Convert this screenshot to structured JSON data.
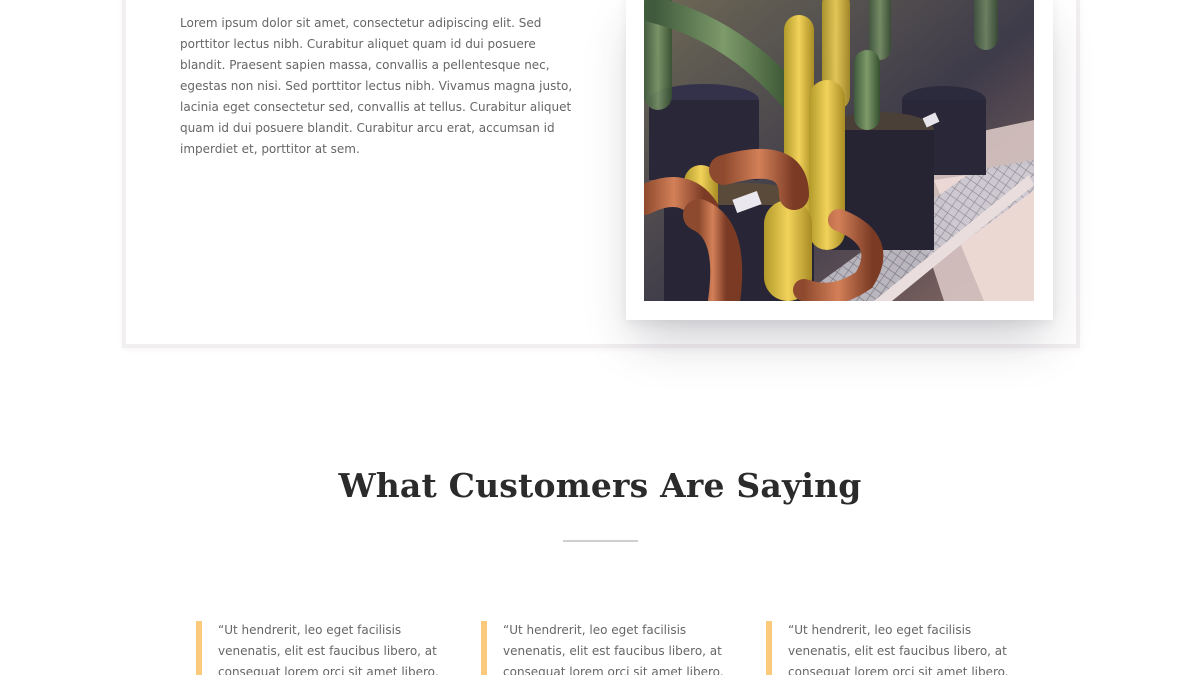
{
  "feature": {
    "body": "Lorem ipsum dolor sit amet, consectetur adipiscing elit. Sed porttitor lectus nibh. Curabitur aliquet quam id dui posuere blandit. Praesent sapien massa, convallis a pellentesque nec, egestas non nisi. Sed porttitor lectus nibh. Vivamus magna justo, lacinia eget consectetur sed, convallis at tellus. Curabitur aliquet quam id dui posuere blandit. Curabitur arcu erat, accumsan id imperdiet et, porttitor at sem.",
    "image_subject": "potted cacti photo"
  },
  "testimonials": {
    "title": "What Customers Are Saying",
    "accent_color": "#fcca7d",
    "items": [
      {
        "quote": "“Ut hendrerit, leo eget facilisis venenatis, elit est faucibus libero, at consequat lorem orci sit amet libero."
      },
      {
        "quote": "“Ut hendrerit, leo eget facilisis venenatis, elit est faucibus libero, at consequat lorem orci sit amet libero."
      },
      {
        "quote": "“Ut hendrerit, leo eget facilisis venenatis, elit est faucibus libero, at consequat lorem orci sit amet libero."
      }
    ]
  }
}
